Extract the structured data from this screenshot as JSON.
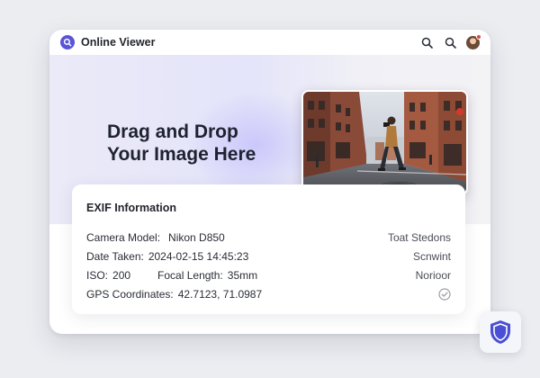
{
  "app": {
    "title": "Online Viewer",
    "logo_icon": "viewer-logo-icon",
    "accent_color": "#5a55d8"
  },
  "toolbar": {
    "icons": [
      "search-icon",
      "search-icon",
      "avatar"
    ],
    "notification_color": "#e5473f"
  },
  "hero": {
    "drop_text_line1": "Drag and Drop",
    "drop_text_line2": "Your Image Here",
    "preview_icon": "street-photo-preview"
  },
  "exif": {
    "title": "EXIF Information",
    "camera_model_label": "Camera Model:",
    "camera_model_value": "Nikon D850",
    "camera_right": "Toat Stedons",
    "date_taken_label": "Date Taken:",
    "date_taken_value": "2024-02-15 14:45:23",
    "date_right": "Scnwint",
    "iso_label": "ISO:",
    "iso_value": "200",
    "focal_length_label": "Focal Length:",
    "focal_length_value": "35mm",
    "iso_right": "Norioor",
    "gps_label": "GPS Coordinates:",
    "gps_value": "42.7123, 71.0987",
    "gps_right_icon": "check-circle-icon"
  },
  "shield": {
    "icon": "shield-icon",
    "color": "#4a4fd6"
  }
}
